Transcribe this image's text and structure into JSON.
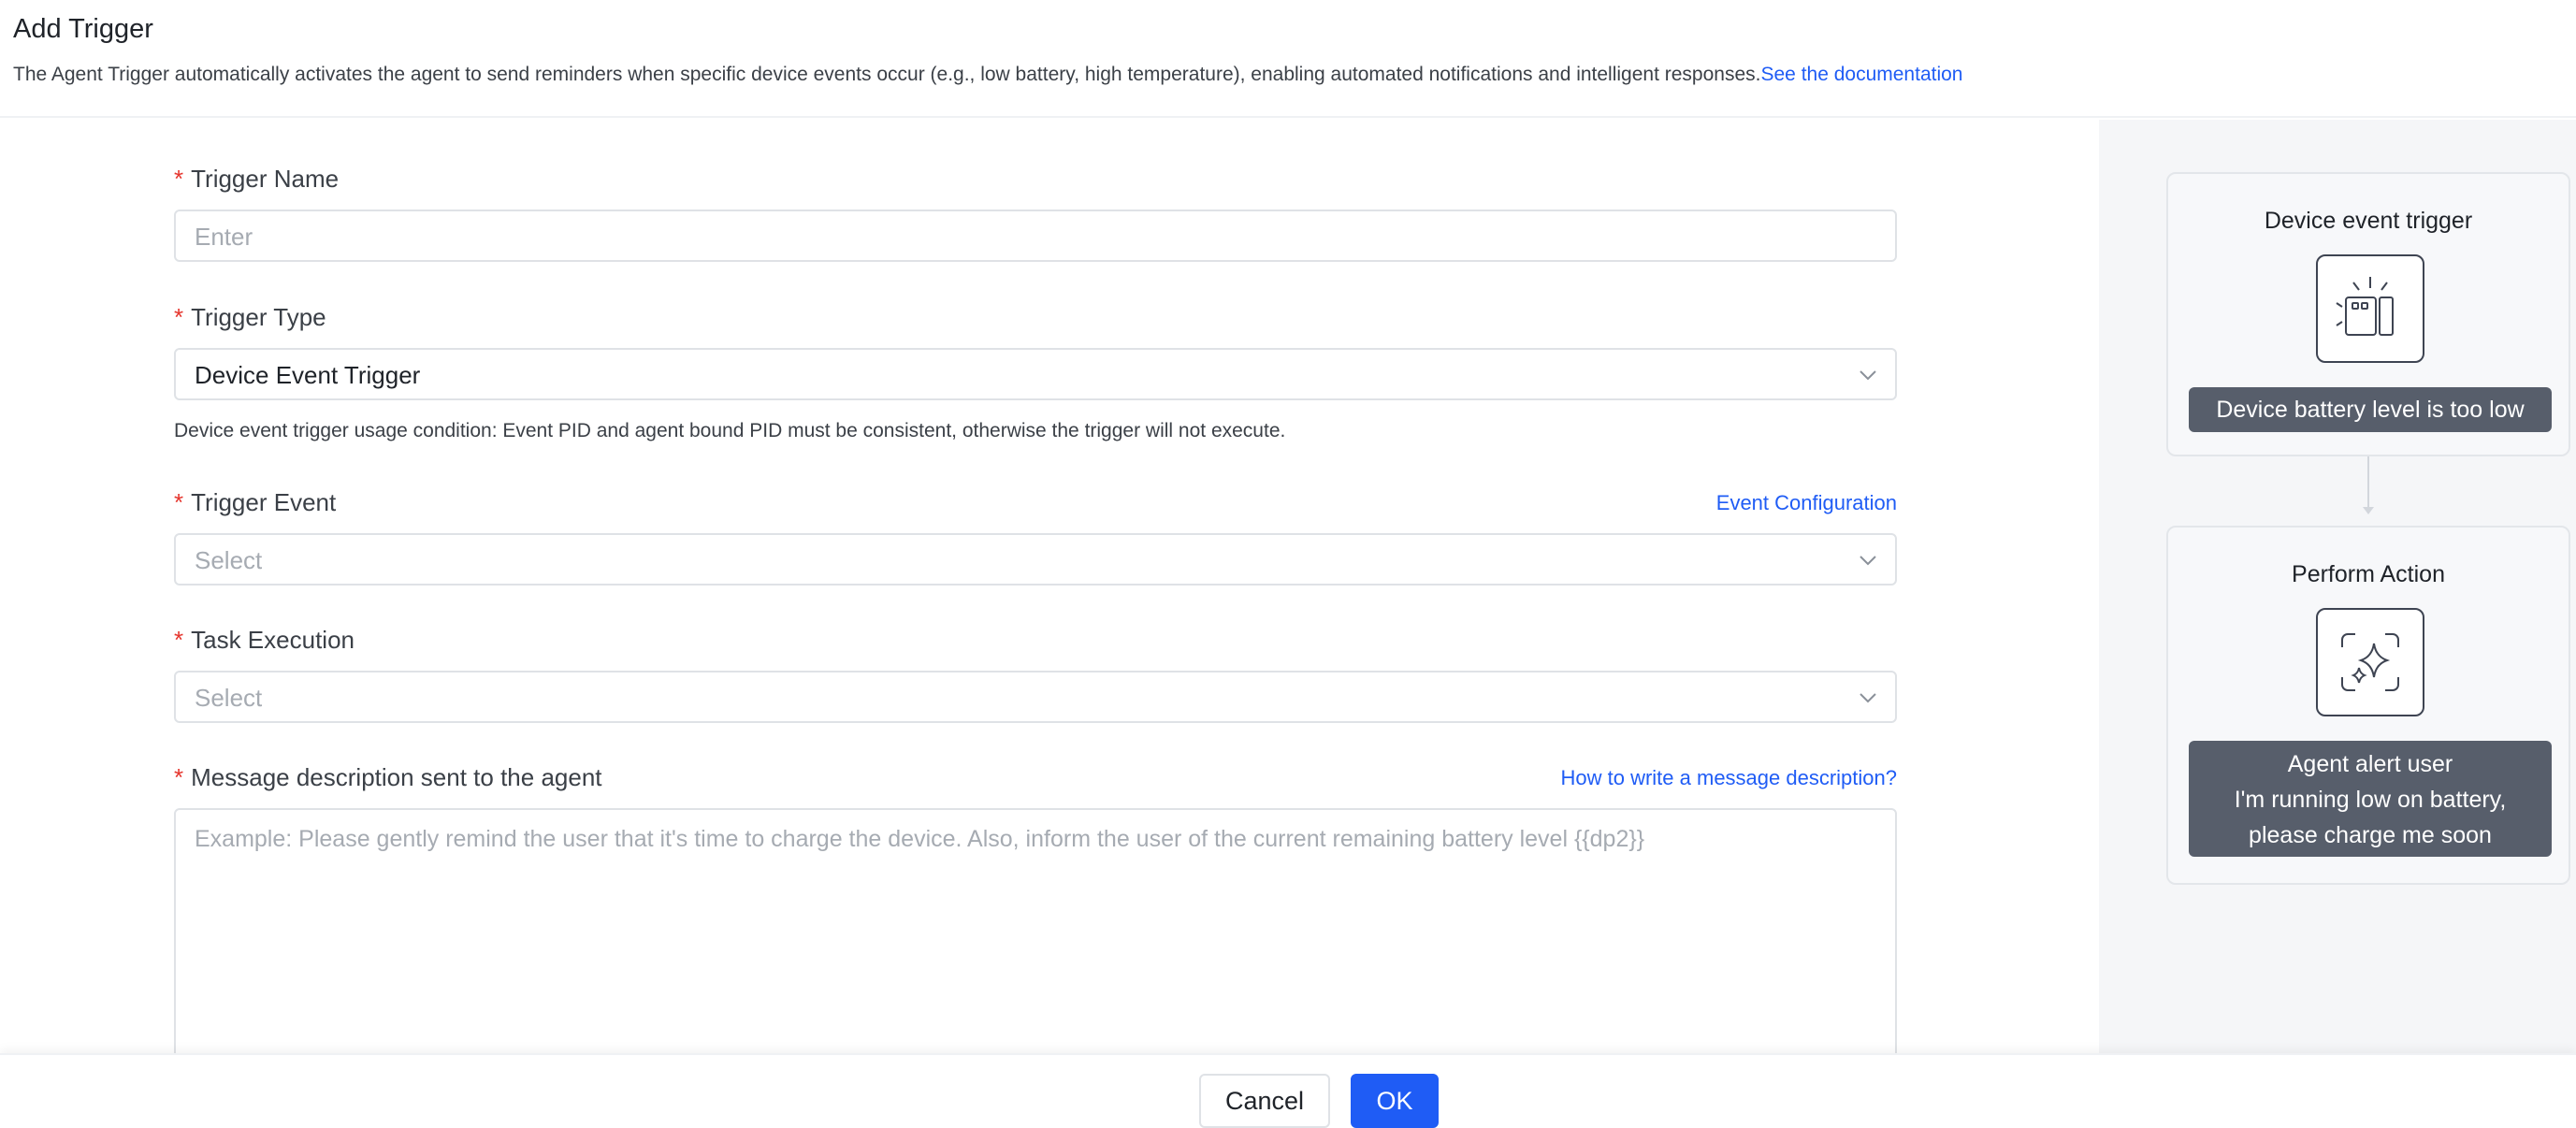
{
  "header": {
    "title": "Add Trigger",
    "description": "The Agent Trigger automatically activates the agent to send reminders when specific device events occur (e.g., low battery, high temperature), enabling automated notifications and intelligent responses.",
    "doc_link": "See the documentation"
  },
  "form": {
    "trigger_name": {
      "label": "Trigger Name",
      "placeholder": "Enter"
    },
    "trigger_type": {
      "label": "Trigger Type",
      "value": "Device Event Trigger",
      "hint": "Device event trigger usage condition: Event PID and agent bound PID must be consistent, otherwise the trigger will not execute."
    },
    "trigger_event": {
      "label": "Trigger Event",
      "link": "Event Configuration",
      "placeholder": "Select"
    },
    "task_execution": {
      "label": "Task Execution",
      "placeholder": "Select"
    },
    "message": {
      "label": "Message description sent to the agent",
      "link": "How to write a message description?",
      "placeholder": "Example: Please gently remind the user that it's time to charge the device. Also, inform the user of the current remaining battery level {{dp2}}"
    },
    "required_mark": "*"
  },
  "preview": {
    "trigger_card": {
      "title": "Device event trigger",
      "icon": "device-sensor-icon",
      "message": "Device battery level is too low"
    },
    "action_card": {
      "title": "Perform Action",
      "icon": "ai-sparkle-icon",
      "message_lines": [
        "Agent alert user",
        "I'm running low on battery,",
        "please charge me soon"
      ]
    }
  },
  "footer": {
    "cancel_label": "Cancel",
    "ok_label": "OK"
  },
  "colors": {
    "accent": "#1f5cf5",
    "required": "#e5352d",
    "pill_bg": "#575e6b"
  }
}
